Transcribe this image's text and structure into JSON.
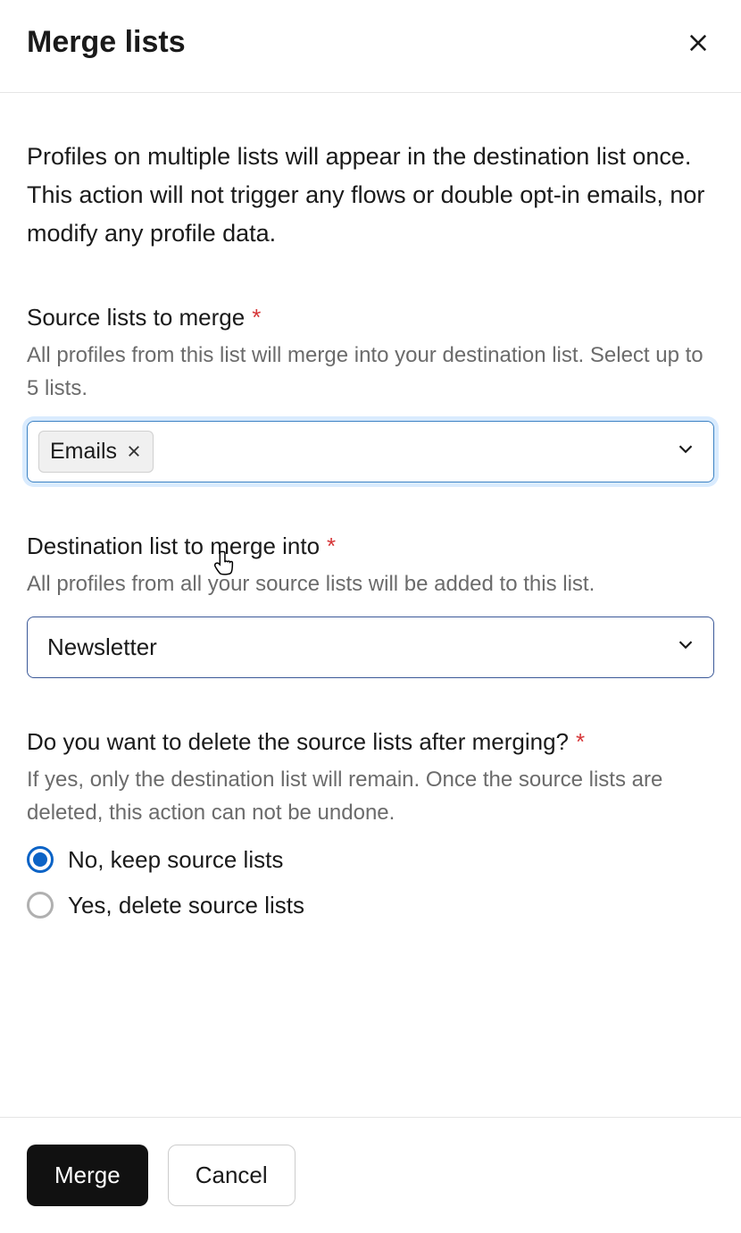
{
  "header": {
    "title": "Merge lists"
  },
  "description": "Profiles on multiple lists will appear in the destination list once. This action will not trigger any flows or double opt-in emails, nor modify any profile data.",
  "source": {
    "label": "Source lists to merge",
    "help": "All profiles from this list will merge into your destination list. Select up to 5 lists.",
    "chips": [
      {
        "label": "Emails"
      }
    ]
  },
  "destination": {
    "label": "Destination list to merge into",
    "help": "All profiles from all your source lists will be added to this list.",
    "value": "Newsletter"
  },
  "deleteSource": {
    "label": "Do you want to delete the source lists after merging?",
    "help": "If yes, only the destination list will remain. Once the source lists are deleted, this action can not be undone.",
    "options": {
      "no": "No, keep source lists",
      "yes": "Yes, delete source lists"
    },
    "selected": "no"
  },
  "footer": {
    "merge": "Merge",
    "cancel": "Cancel"
  },
  "required_mark": "*"
}
